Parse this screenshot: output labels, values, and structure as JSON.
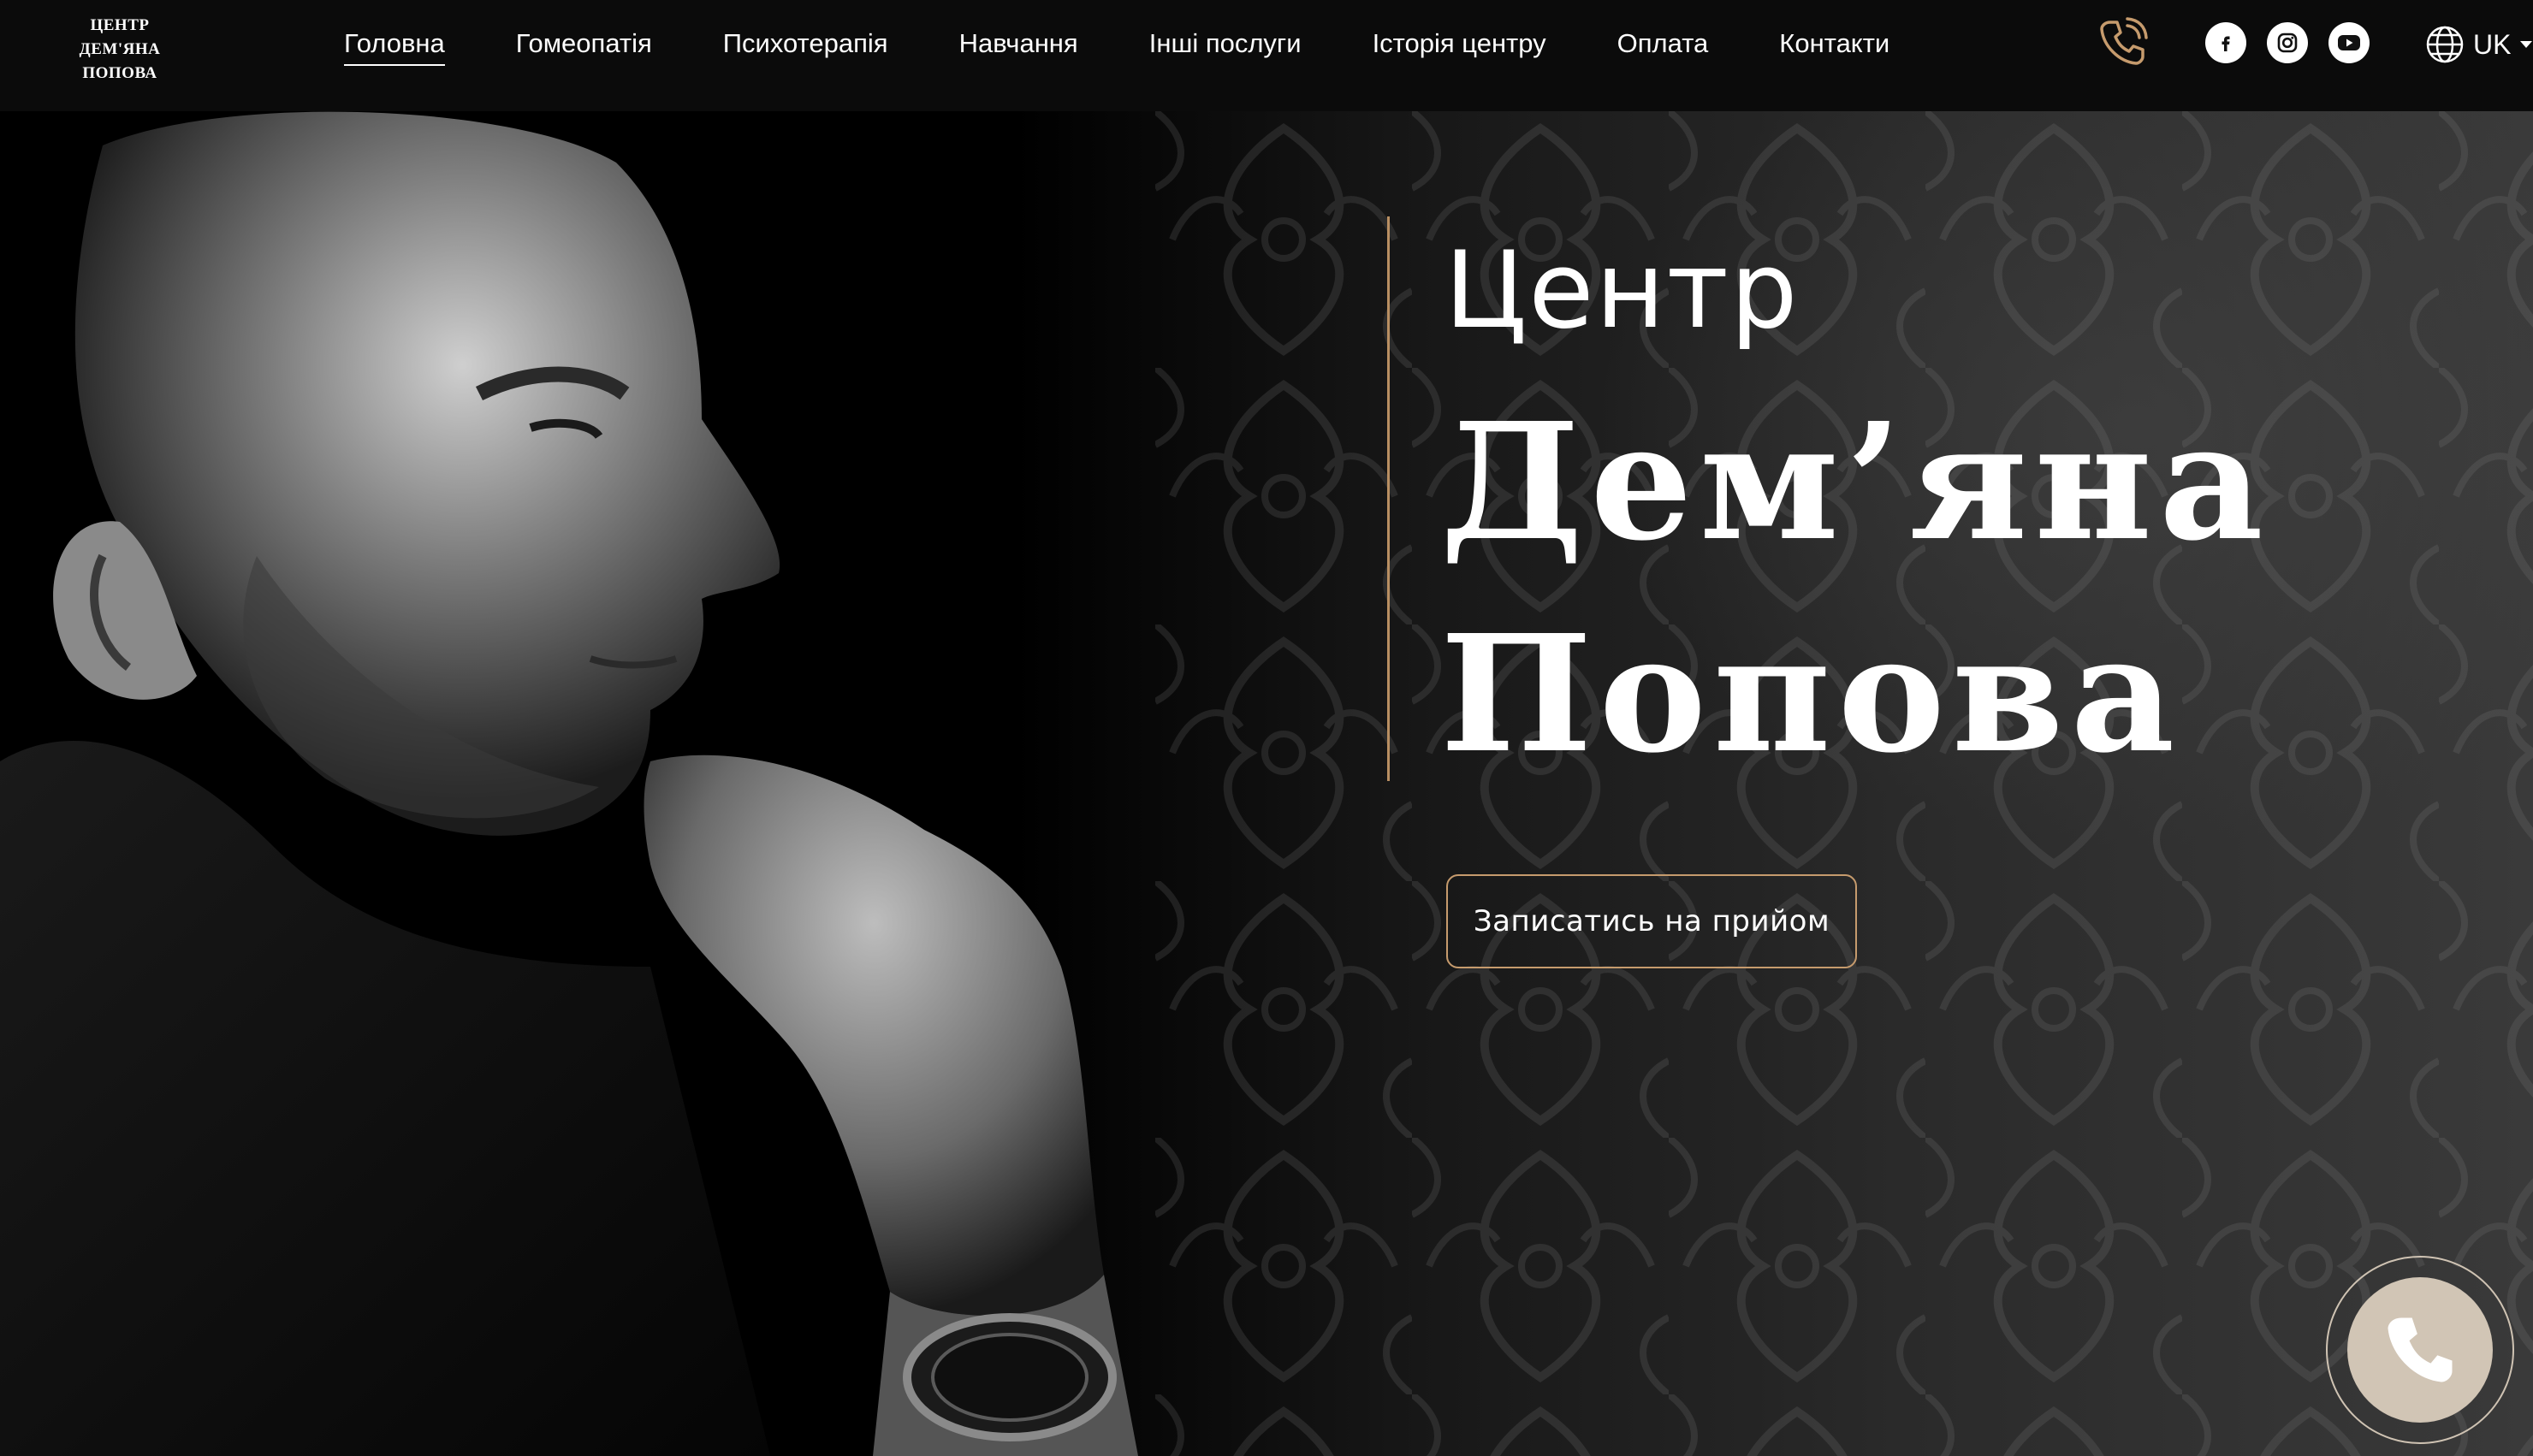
{
  "logo": {
    "line1": "ЦЕНТР",
    "line2": "ДЕМ'ЯНА",
    "line3": "ПОПОВА"
  },
  "nav": {
    "items": [
      {
        "label": "Головна",
        "active": true
      },
      {
        "label": "Гомеопатія",
        "active": false
      },
      {
        "label": "Психотерапія",
        "active": false
      },
      {
        "label": "Навчання",
        "active": false
      },
      {
        "label": "Інші послуги",
        "active": false
      },
      {
        "label": "Історія центру",
        "active": false
      },
      {
        "label": "Оплата",
        "active": false
      },
      {
        "label": "Контакти",
        "active": false
      }
    ]
  },
  "header": {
    "phone_icon": "phone-icon",
    "socials": [
      "facebook-icon",
      "instagram-icon",
      "youtube-icon"
    ],
    "language": "UK"
  },
  "hero": {
    "title_line1": "Центр",
    "title_line2": "Дем’яна",
    "title_line3": "Попова",
    "cta_label": "Записатись на прийом"
  },
  "floating_call": {
    "icon": "phone-icon"
  },
  "colors": {
    "accent": "#c69b6d",
    "header_bg": "#0b0b0b",
    "fab_bg": "#d1c5b5"
  }
}
